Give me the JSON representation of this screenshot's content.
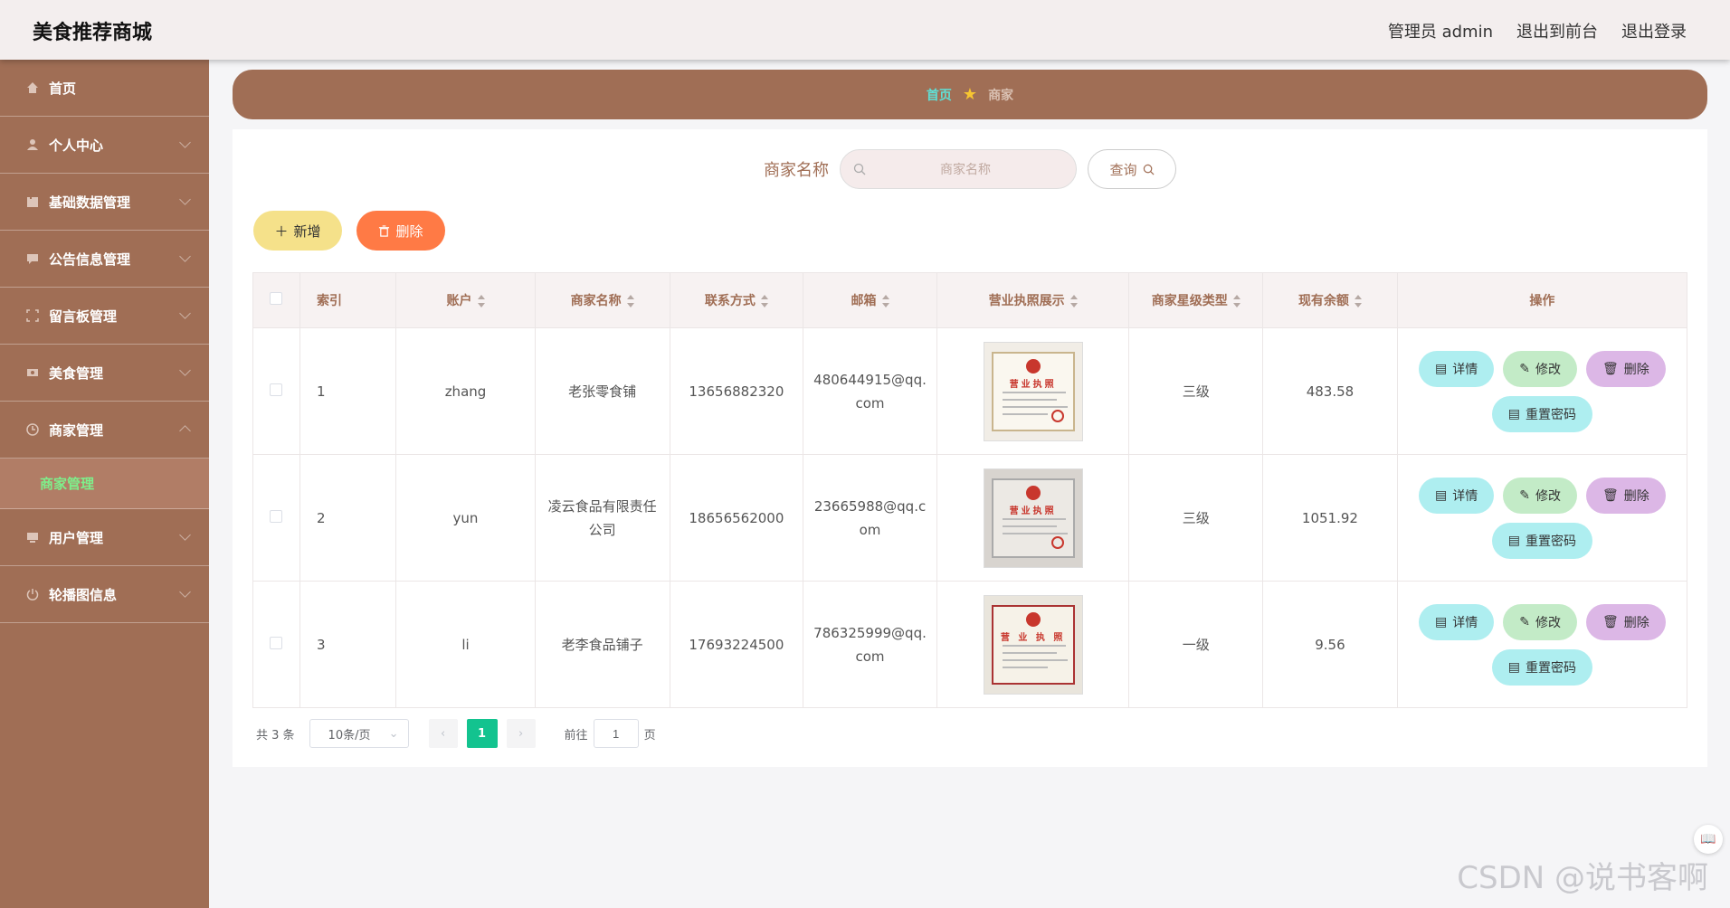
{
  "header": {
    "title": "美食推荐商城",
    "links": [
      "管理员 admin",
      "退出到前台",
      "退出登录"
    ]
  },
  "sidebar": {
    "items": [
      {
        "label": "首页",
        "icon": "home-icon"
      },
      {
        "label": "个人中心",
        "icon": "user-icon"
      },
      {
        "label": "基础数据管理",
        "icon": "data-icon"
      },
      {
        "label": "公告信息管理",
        "icon": "message-icon"
      },
      {
        "label": "留言板管理",
        "icon": "frame-icon"
      },
      {
        "label": "美食管理",
        "icon": "food-icon"
      },
      {
        "label": "商家管理",
        "icon": "clock-icon"
      },
      {
        "label": "用户管理",
        "icon": "monitor-icon"
      },
      {
        "label": "轮播图信息",
        "icon": "power-icon"
      }
    ],
    "sub_item": "商家管理"
  },
  "breadcrumb": {
    "home": "首页",
    "current": "商家"
  },
  "search": {
    "label": "商家名称",
    "placeholder": "商家名称",
    "button": "查询"
  },
  "actions": {
    "add": "新增",
    "delete": "删除"
  },
  "table": {
    "columns": [
      "索引",
      "账户",
      "商家名称",
      "联系方式",
      "邮箱",
      "营业执照展示",
      "商家星级类型",
      "现有余额",
      "操作"
    ],
    "rows": [
      {
        "index": "1",
        "account": "zhang",
        "name": "老张零食铺",
        "phone": "13656882320",
        "email": "480644915@qq.com",
        "star": "三级",
        "balance": "483.58"
      },
      {
        "index": "2",
        "account": "yun",
        "name": "凌云食品有限责任公司",
        "phone": "18656562000",
        "email": "23665988@qq.com",
        "star": "三级",
        "balance": "1051.92"
      },
      {
        "index": "3",
        "account": "li",
        "name": "老李食品铺子",
        "phone": "17693224500",
        "email": "786325999@qq.com",
        "star": "一级",
        "balance": "9.56"
      }
    ],
    "row_ops": {
      "detail": "详情",
      "edit": "修改",
      "remove": "删除",
      "reset": "重置密码"
    }
  },
  "pagination": {
    "total": "共 3 条",
    "page_size": "10条/页",
    "current": "1",
    "goto_label": "前往",
    "goto_value": "1",
    "page_unit": "页"
  },
  "license_texts": [
    "营业执照",
    "营业执照",
    "营 业 执 照"
  ],
  "watermark": "CSDN @说书客啊",
  "colors": {
    "sidebar": "#a06e55",
    "accent_green": "#13c38f",
    "breadcrumb_home": "#5fe0d6"
  }
}
